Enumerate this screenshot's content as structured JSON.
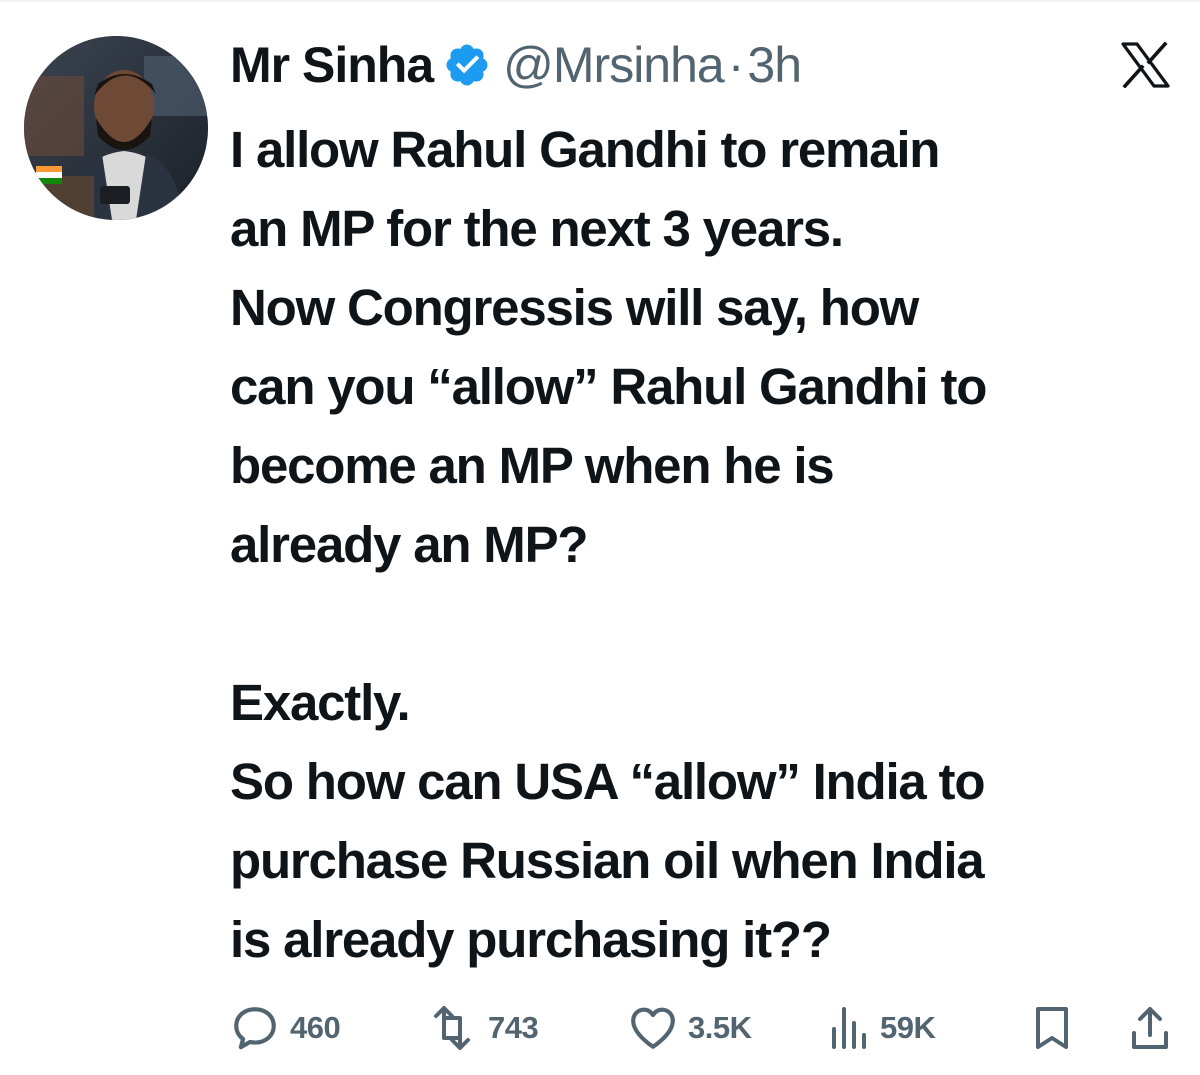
{
  "tweet": {
    "author": {
      "display_name": "Mr Sinha",
      "handle": "@Mrsinha",
      "verified": true,
      "avatar_icon": "profile-photo"
    },
    "separator": "·",
    "timestamp": "3h",
    "platform_icon": "x-logo-icon",
    "text_lines": [
      "I allow Rahul Gandhi to remain",
      "an MP for the next 3 years.",
      "Now Congressis will say, how",
      "can you “allow” Rahul Gandhi to",
      "become an MP when he is",
      "already an MP?",
      "",
      "Exactly.",
      "So how can USA “allow” India to",
      "purchase Russian oil when India",
      "is already purchasing it??"
    ],
    "metrics": {
      "replies": "460",
      "reposts": "743",
      "likes": "3.5K",
      "views": "59K"
    }
  },
  "colors": {
    "text_primary": "#0f1419",
    "text_secondary": "#536471",
    "verified_blue": "#1d9bf0"
  }
}
